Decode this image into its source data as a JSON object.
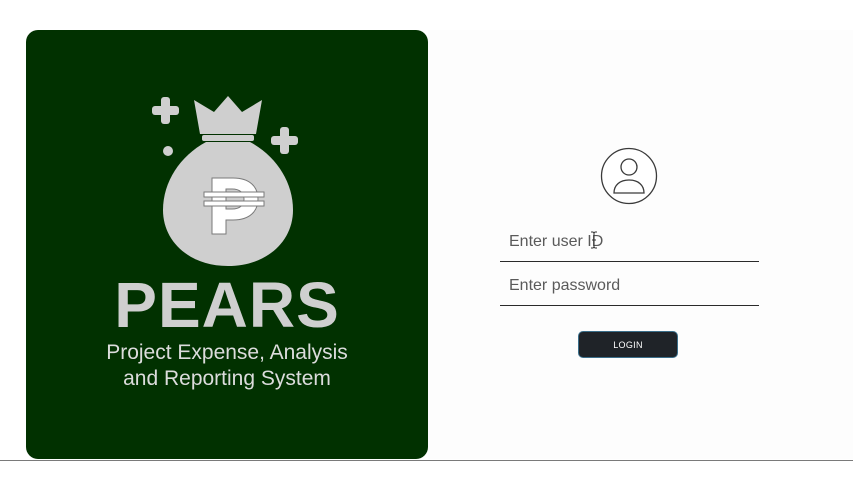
{
  "brand": {
    "title": "PEARS",
    "subtitle_line1": "Project Expense, Analysis",
    "subtitle_line2": "and Reporting System",
    "logo_icon": "money-bag-peso-icon",
    "panel_color": "#013100",
    "logo_color": "#cfcfcf"
  },
  "login": {
    "avatar_icon": "user-circle-icon",
    "user_id": {
      "placeholder": "Enter user ID",
      "value": ""
    },
    "password": {
      "placeholder": "Enter password",
      "value": ""
    },
    "button_label": "LOGIN",
    "button_color": "#1f2328"
  }
}
